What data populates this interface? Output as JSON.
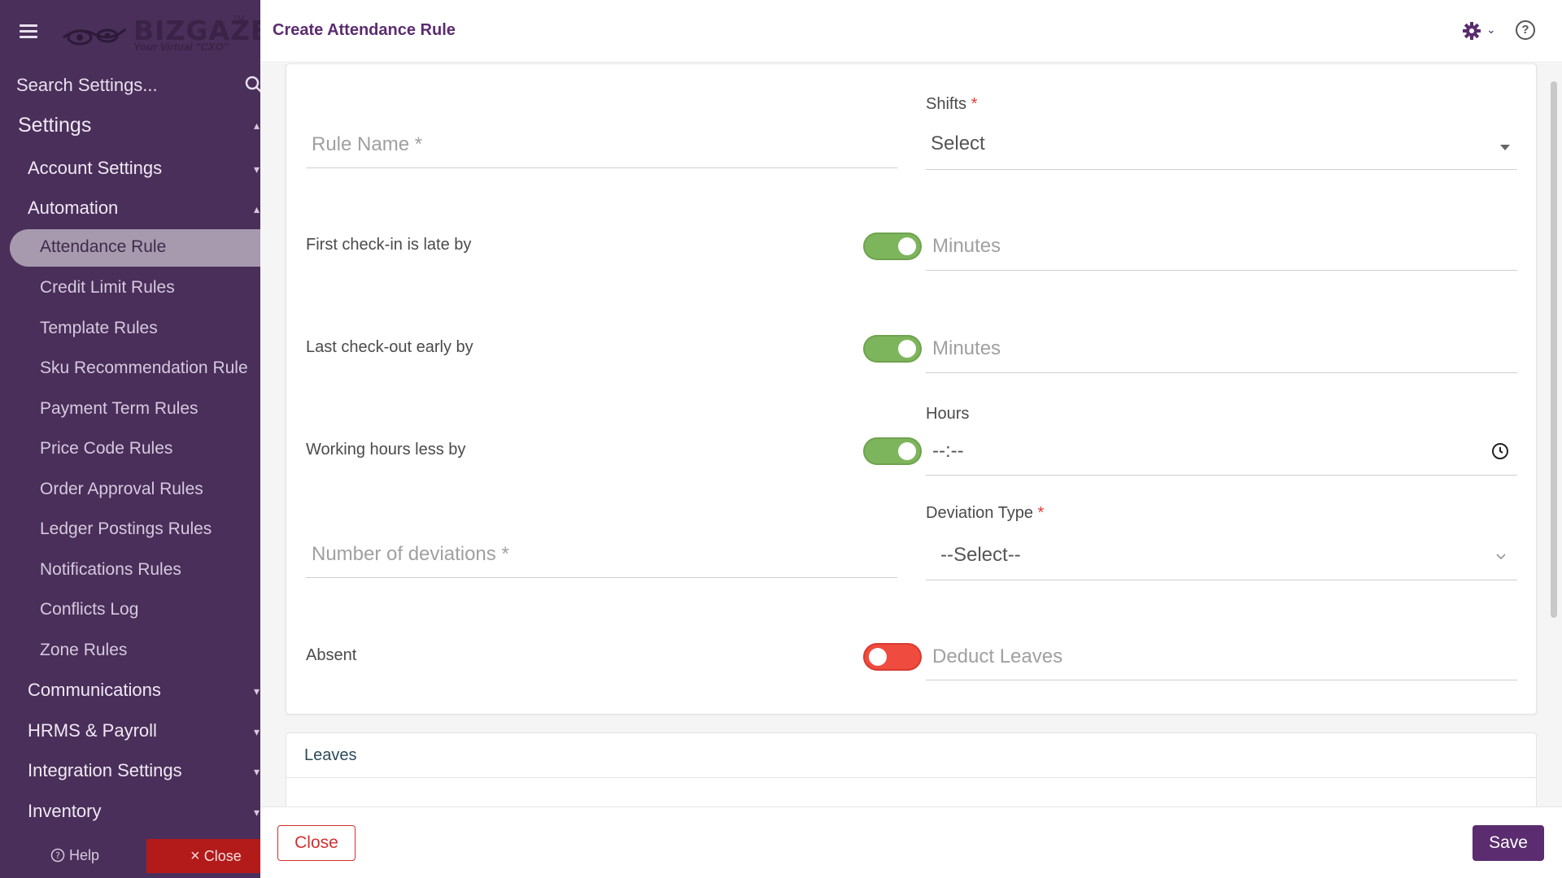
{
  "sidebar": {
    "logo_text": "BIZGAZE",
    "logo_tagline": "Your Virtual \"CXO\"",
    "logo_tm": "TM",
    "search_placeholder": "Search Settings...",
    "section_title": "Settings",
    "groups": {
      "account_settings": "Account Settings",
      "automation": "Automation",
      "communications": "Communications",
      "hrms_payroll": "HRMS & Payroll",
      "integration_settings": "Integration Settings",
      "inventory": "Inventory"
    },
    "automation_items": [
      "Attendance Rule",
      "Credit Limit Rules",
      "Template Rules",
      "Sku Recommendation Rule",
      "Payment Term Rules",
      "Price Code Rules",
      "Order Approval Rules",
      "Ledger Postings Rules",
      "Notifications Rules",
      "Conflicts Log",
      "Zone Rules"
    ],
    "active_item": "Attendance Rule",
    "help_label": "Help",
    "close_label": "Close"
  },
  "header": {
    "title": "Create Attendance Rule",
    "help_icon_glyph": "?"
  },
  "form": {
    "rule_name_placeholder": "Rule Name *",
    "shifts_label": "Shifts",
    "required_mark": "*",
    "shifts_value": "Select",
    "first_checkin_label": "First check-in is late by",
    "first_checkin_toggle": "on",
    "first_checkin_placeholder": "Minutes",
    "last_checkout_label": "Last check-out early by",
    "last_checkout_toggle": "on",
    "last_checkout_placeholder": "Minutes",
    "working_hours_label": "Working hours less by",
    "working_hours_toggle": "on",
    "hours_label": "Hours",
    "hours_value": "--:--",
    "deviations_placeholder": "Number of deviations *",
    "deviation_type_label": "Deviation Type",
    "deviation_type_value": "--Select--",
    "absent_label": "Absent",
    "absent_toggle": "off",
    "deduct_leaves_placeholder": "Deduct Leaves"
  },
  "leaves": {
    "title": "Leaves"
  },
  "footer": {
    "close_label": "Close",
    "save_label": "Save"
  },
  "colors": {
    "sidebar_bg": "#4a2f5a",
    "accent": "#5b2c6f",
    "toggle_on": "#7db55c",
    "toggle_off": "#ef4b3f",
    "danger": "#d32f2f"
  }
}
